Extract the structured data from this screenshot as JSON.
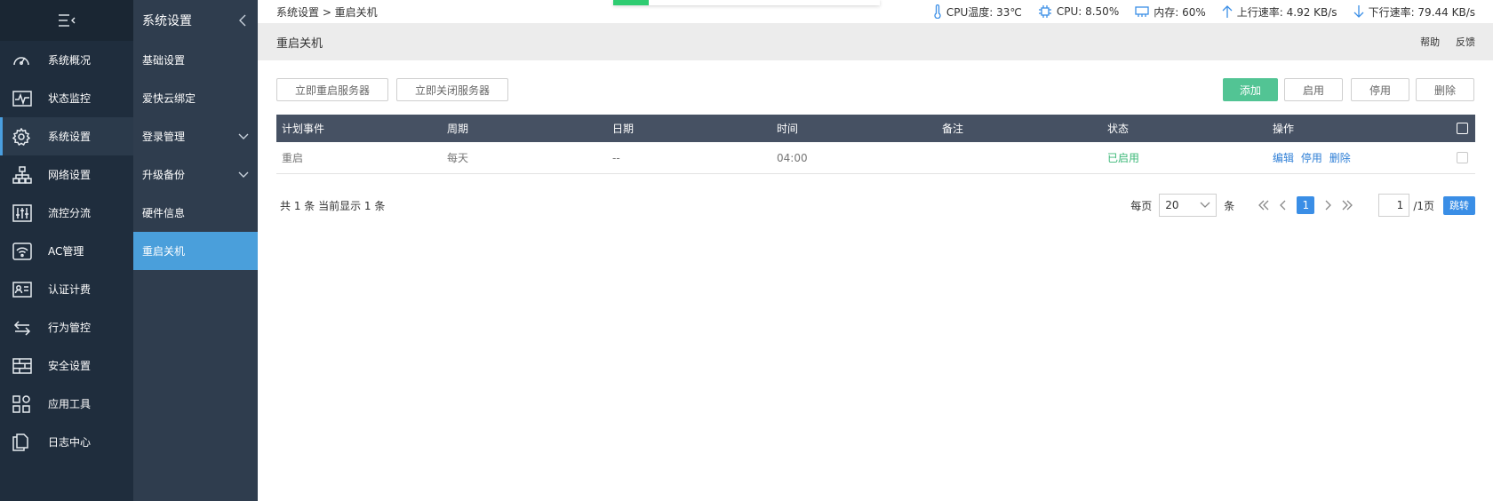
{
  "nav_primary": {
    "items": [
      {
        "label": "系统概况",
        "icon": "dashboard-icon"
      },
      {
        "label": "状态监控",
        "icon": "monitor-icon"
      },
      {
        "label": "系统设置",
        "icon": "gear-icon"
      },
      {
        "label": "网络设置",
        "icon": "network-icon"
      },
      {
        "label": "流控分流",
        "icon": "sliders-icon"
      },
      {
        "label": "AC管理",
        "icon": "wifi-icon"
      },
      {
        "label": "认证计费",
        "icon": "id-card-icon"
      },
      {
        "label": "行为管控",
        "icon": "arrows-icon"
      },
      {
        "label": "安全设置",
        "icon": "firewall-icon"
      },
      {
        "label": "应用工具",
        "icon": "apps-icon"
      },
      {
        "label": "日志中心",
        "icon": "document-icon"
      }
    ],
    "active_index": 2
  },
  "nav_secondary": {
    "title": "系统设置",
    "items": [
      {
        "label": "基础设置"
      },
      {
        "label": "爱快云绑定"
      },
      {
        "label": "登录管理"
      },
      {
        "label": "升级备份"
      },
      {
        "label": "硬件信息"
      },
      {
        "label": "重启关机"
      }
    ],
    "active_index": 5
  },
  "breadcrumb": "系统设置 > 重启关机",
  "stats": {
    "cpu_temp": "CPU温度: 33℃",
    "cpu": "CPU: 8.50%",
    "memory": "内存: 60%",
    "upload": "上行速率: 4.92 KB/s",
    "download": "下行速率: 79.44 KB/s"
  },
  "page": {
    "title": "重启关机",
    "help": "帮助",
    "feedback": "反馈"
  },
  "toolbar": {
    "reboot_now": "立即重启服务器",
    "shutdown_now": "立即关闭服务器",
    "add": "添加",
    "enable": "启用",
    "disable": "停用",
    "delete": "删除"
  },
  "table": {
    "headers": [
      "计划事件",
      "周期",
      "日期",
      "时间",
      "备注",
      "状态",
      "操作"
    ],
    "rows": [
      {
        "event": "重启",
        "period": "每天",
        "date": "--",
        "time": "04:00",
        "note": "",
        "status": "已启用",
        "ops": [
          "编辑",
          "停用",
          "删除"
        ]
      }
    ]
  },
  "footer": {
    "summary": "共 1 条 当前显示 1 条",
    "per_page_label": "每页",
    "per_page_value": "20",
    "unit": "条",
    "current_page": "1",
    "page_input": "1",
    "total_pages": "/1页",
    "jump": "跳转"
  },
  "colors": {
    "nav_bg": "#1f2d3d",
    "subnav_bg": "#2f3d4e",
    "active_subnav": "#4a9fdb",
    "table_header": "#465163",
    "add_button": "#52c494",
    "accent": "#3a8ee6",
    "enabled_status": "#3cb878"
  }
}
